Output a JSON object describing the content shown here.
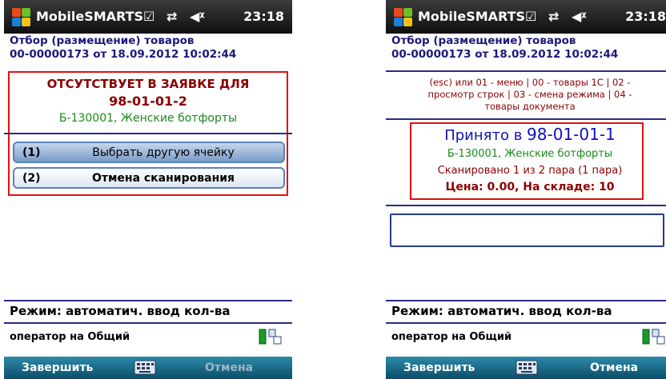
{
  "statusbar": {
    "app_name": "MobileSMARTS",
    "time": "23:18"
  },
  "document": {
    "title_line1": "Отбор (размещение) товаров",
    "title_line2": "00-00000173 от 18.09.2012 10:02:44"
  },
  "left_screen": {
    "alert": {
      "line1": "ОТСУТСТВУЕТ В ЗАЯВКЕ ДЛЯ",
      "line2": "98-01-01-2",
      "line3": "Б-130001, Женские ботфорты"
    },
    "buttons": [
      {
        "number": "(1)",
        "label": "Выбрать другую ячейку"
      },
      {
        "number": "(2)",
        "label": "Отмена сканирования"
      }
    ]
  },
  "right_screen": {
    "hint_lines": [
      "(esc) или 01 - меню | 00 - товары 1С | 02 -",
      "просмотр строк | 03 - смена режима | 04 -",
      "товары документа"
    ],
    "accepted": {
      "prefix": "Принято в",
      "cell": "98-01-01-1",
      "product": "Б-130001, Женские ботфорты",
      "scanned": "Сканировано 1 из 2 пара (1 пара)",
      "price_stock": "Цена: 0.00, На складе: 10"
    },
    "input_value": ""
  },
  "footer": {
    "mode": "Режим: автоматич. ввод кол-ва",
    "operator": "оператор на Общий"
  },
  "softkeys": {
    "left": "Завершить",
    "right": "Отмена"
  },
  "colors": {
    "title": "#1a1a7a",
    "alert_red": "#8b0000",
    "product_green": "#1a8a1a",
    "accepted_blue": "#1010c0",
    "frame_red": "#e01010"
  },
  "icons": [
    "windows-logo-icon",
    "edit-icon",
    "sync-icon",
    "volume-icon",
    "network-icon",
    "keyboard-icon"
  ]
}
